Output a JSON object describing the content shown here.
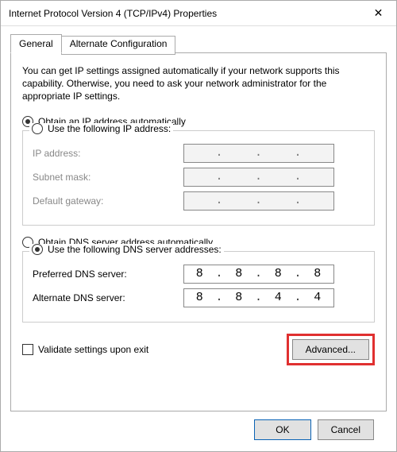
{
  "window": {
    "title": "Internet Protocol Version 4 (TCP/IPv4) Properties"
  },
  "tabs": {
    "general": "General",
    "alternate": "Alternate Configuration"
  },
  "intro": "You can get IP settings assigned automatically if your network supports this capability. Otherwise, you need to ask your network administrator for the appropriate IP settings.",
  "ip": {
    "auto_label": "Obtain an IP address automatically",
    "manual_label": "Use the following IP address:",
    "ip_address_label": "IP address:",
    "subnet_label": "Subnet mask:",
    "gateway_label": "Default gateway:",
    "ip_address": [
      "",
      "",
      "",
      ""
    ],
    "subnet": [
      "",
      "",
      "",
      ""
    ],
    "gateway": [
      "",
      "",
      "",
      ""
    ]
  },
  "dns": {
    "auto_label": "Obtain DNS server address automatically",
    "manual_label": "Use the following DNS server addresses:",
    "preferred_label": "Preferred DNS server:",
    "alternate_label": "Alternate DNS server:",
    "preferred": [
      "8",
      "8",
      "8",
      "8"
    ],
    "alternate": [
      "8",
      "8",
      "4",
      "4"
    ]
  },
  "validate_label": "Validate settings upon exit",
  "buttons": {
    "advanced": "Advanced...",
    "ok": "OK",
    "cancel": "Cancel"
  }
}
